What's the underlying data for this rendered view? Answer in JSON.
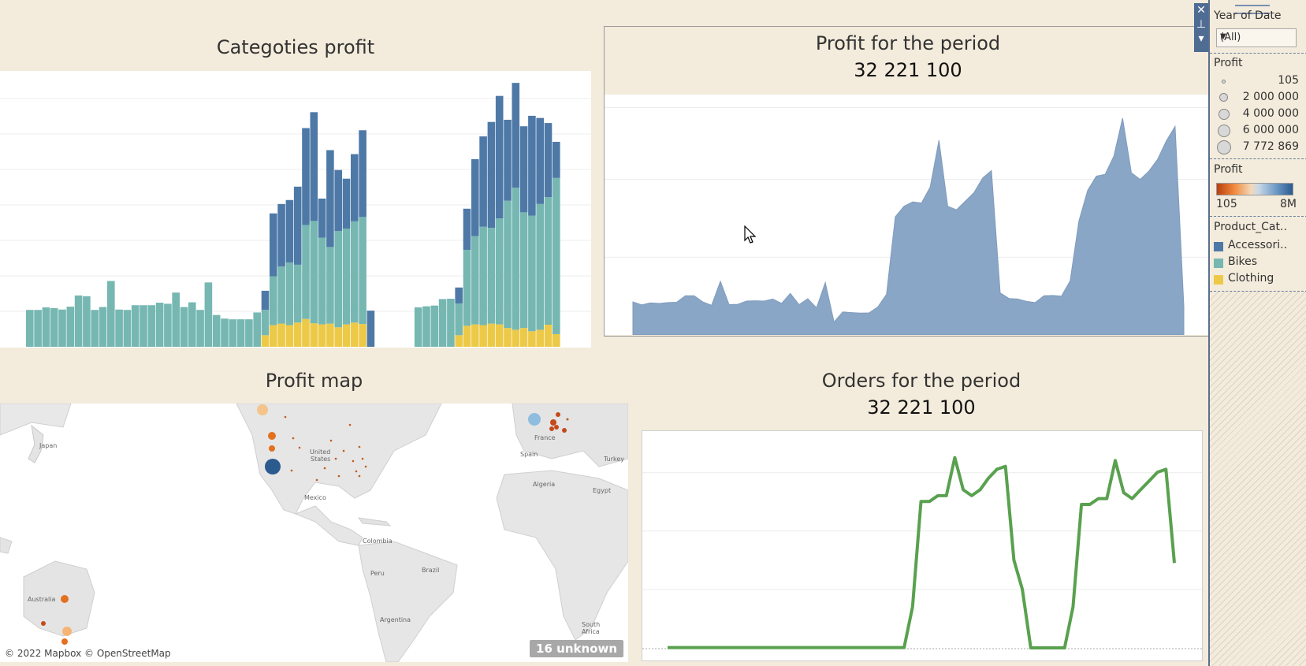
{
  "colors": {
    "background": "#f3ebdb",
    "accessories": "#4e79a7",
    "bikes": "#76b7b2",
    "clothing": "#edc948",
    "area": "#8aa6c6",
    "orders_line": "#59a14f",
    "map_dark": "#2b5a8f",
    "map_orange": "#e3701f",
    "map_light_orange": "#f4b576",
    "map_light_blue": "#8fbde0"
  },
  "categories_chart": {
    "title": "Categoties profit"
  },
  "profit_period": {
    "title": "Profit for the period",
    "value": "32 221 100"
  },
  "map": {
    "title": "Profit map",
    "credit": "© 2022 Mapbox © OpenStreetMap",
    "unknown": "16 unknown",
    "labels": {
      "japan": "Japan",
      "united": "United",
      "states": "States",
      "mexico": "Mexico",
      "colombia": "Colombia",
      "peru": "Peru",
      "brazil": "Brazil",
      "argentina": "Argentina",
      "australia": "Australia",
      "france": "France",
      "spain": "Spain",
      "turkey": "Turkey",
      "algeria": "Algeria",
      "egypt": "Egypt",
      "south": "South",
      "africa": "Africa"
    }
  },
  "orders_period": {
    "title": "Orders for the period",
    "value": "32 221 100"
  },
  "side_panel": {
    "year_label": "Year of Date",
    "year_value": "(All)",
    "size_legend_title": "Profit",
    "size_legend": [
      "105",
      "2 000 000",
      "4 000 000",
      "6 000 000",
      "7 772 869"
    ],
    "color_legend_title": "Profit",
    "color_min": "105",
    "color_max": "8M",
    "category_title": "Product_Cat..",
    "categories": [
      "Accessori..",
      "Bikes",
      "Clothing"
    ]
  },
  "icons": {
    "close": "close-icon",
    "pin": "pin-icon",
    "dropdown": "chevron-down-icon"
  },
  "chart_data": [
    {
      "type": "bar",
      "title": "Categoties profit",
      "stacked": true,
      "grid": true,
      "ylim": [
        0,
        7500000
      ],
      "series": [
        {
          "name": "Bikes",
          "values": [
            1020000,
            1020000,
            1090000,
            1070000,
            1030000,
            1110000,
            1420000,
            1400000,
            1020000,
            1100000,
            1820000,
            1030000,
            1020000,
            1150000,
            1150000,
            1150000,
            1220000,
            1190000,
            1500000,
            1100000,
            1230000,
            1020000,
            1780000,
            880000,
            780000,
            760000,
            760000,
            760000,
            950000,
            700000,
            1350000,
            1580000,
            1730000,
            1600000,
            2600000,
            2830000,
            2400000,
            2120000,
            2660000,
            2650000,
            2800000,
            2960000,
            0,
            1090000,
            1120000,
            1140000,
            1320000,
            1330000,
            880000,
            2100000,
            2440000,
            2720000,
            2650000,
            2930000,
            3520000,
            3930000,
            3200000,
            3200000,
            3480000,
            3530000,
            4320000,
            0
          ]
        },
        {
          "name": "Clothing",
          "values": [
            0,
            0,
            0,
            0,
            0,
            0,
            0,
            0,
            0,
            0,
            0,
            0,
            0,
            0,
            0,
            0,
            0,
            0,
            0,
            0,
            0,
            0,
            0,
            0,
            0,
            0,
            0,
            0,
            0,
            320000,
            600000,
            640000,
            600000,
            670000,
            770000,
            650000,
            620000,
            640000,
            540000,
            620000,
            670000,
            630000,
            0,
            0,
            0,
            0,
            0,
            0,
            320000,
            580000,
            620000,
            600000,
            640000,
            620000,
            520000,
            470000,
            520000,
            430000,
            470000,
            610000,
            350000,
            0
          ]
        },
        {
          "name": "Accessories",
          "values": [
            0,
            0,
            0,
            0,
            0,
            0,
            0,
            0,
            0,
            0,
            0,
            0,
            0,
            0,
            0,
            0,
            0,
            0,
            0,
            0,
            0,
            0,
            0,
            0,
            0,
            0,
            0,
            0,
            0,
            530000,
            1740000,
            1730000,
            1730000,
            2160000,
            2680000,
            3010000,
            1080000,
            2680000,
            1690000,
            1380000,
            1860000,
            2400000,
            1000000,
            0,
            0,
            0,
            0,
            0,
            440000,
            1140000,
            2130000,
            2500000,
            2930000,
            3390000,
            2240000,
            2900000,
            2380000,
            2760000,
            2380000,
            2050000,
            1000000
          ]
        }
      ]
    },
    {
      "type": "area",
      "title": "Profit for the period",
      "grid": true,
      "ylim": [
        0,
        8000000
      ],
      "values": [
        1120000,
        1020000,
        1090000,
        1070000,
        1100000,
        1110000,
        1330000,
        1330000,
        1120000,
        1010000,
        1820000,
        1030000,
        1040000,
        1150000,
        1160000,
        1150000,
        1220000,
        1070000,
        1410000,
        1030000,
        1230000,
        920000,
        1780000,
        440000,
        780000,
        760000,
        740000,
        750000,
        950000,
        1380000,
        4010000,
        4370000,
        4520000,
        4480000,
        5020000,
        6610000,
        4370000,
        4250000,
        4540000,
        4830000,
        5330000,
        5580000,
        1430000,
        1240000,
        1220000,
        1140000,
        1100000,
        1330000,
        1340000,
        1320000,
        1840000,
        3870000,
        4910000,
        5390000,
        5450000,
        6070000,
        7360000,
        5510000,
        5280000,
        5560000,
        5960000,
        6590000,
        7080000,
        970000
      ]
    },
    {
      "type": "line",
      "title": "Orders for the period",
      "grid": true,
      "ylim": [
        0,
        3500
      ],
      "values": [
        5,
        5,
        5,
        5,
        5,
        5,
        5,
        5,
        5,
        5,
        5,
        5,
        5,
        5,
        5,
        5,
        5,
        5,
        5,
        5,
        5,
        5,
        5,
        5,
        5,
        5,
        5,
        5,
        5,
        700,
        2500,
        2500,
        2600,
        2600,
        3250,
        2700,
        2600,
        2700,
        2900,
        3050,
        3100,
        1500,
        1000,
        0,
        0,
        0,
        0,
        0,
        700,
        2450,
        2450,
        2550,
        2550,
        3200,
        2650,
        2550,
        2700,
        2850,
        3000,
        3050,
        1450
      ]
    }
  ]
}
